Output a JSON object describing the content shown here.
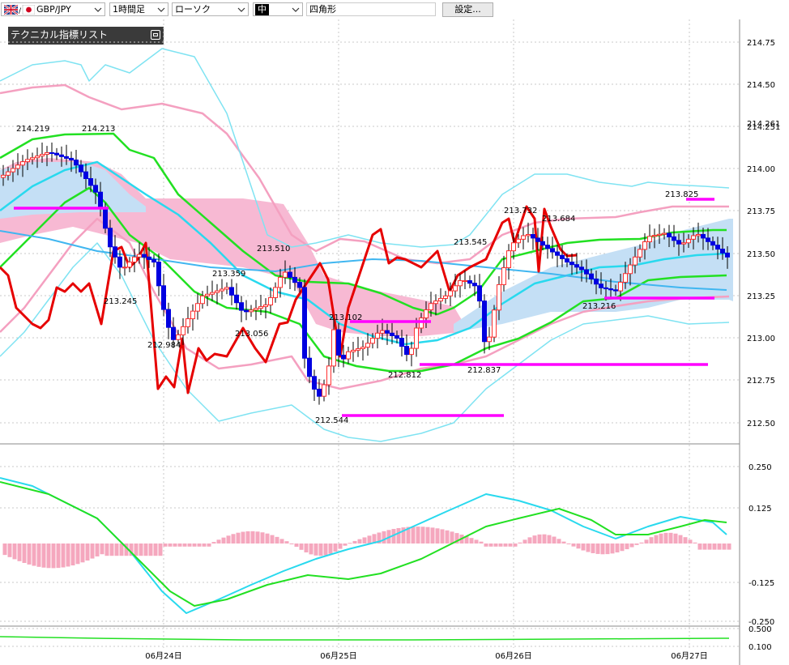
{
  "toolbar": {
    "pair": "GBP/JPY",
    "timeframe": "1時間足",
    "chart_style": "ローソク",
    "mode": "中",
    "draw_tool": "四角形",
    "settings": "設定..."
  },
  "tech_list": {
    "label": "テクニカル指標リスト"
  },
  "chart_data": [
    {
      "type": "candlestick",
      "title": "",
      "indicators": [
        "bollinger-bands",
        "ichimoku-cloud",
        "moving-averages",
        "rsi-style-line"
      ],
      "price_range": [
        212.45,
        214.86
      ],
      "y_ticks": [
        "214.75",
        "214.50",
        "214.261",
        "214.251",
        "214.00",
        "213.75",
        "213.50",
        "213.25",
        "213.00",
        "212.75",
        "212.50"
      ],
      "x_ticks": [
        "06月24日",
        "06月25日",
        "06月26日",
        "06月27日"
      ],
      "annotations": [
        "214.219",
        "214.213",
        "213.245",
        "212.984",
        "213.359",
        "213.056",
        "213.510",
        "213.102",
        "212.544",
        "212.812",
        "213.545",
        "212.837",
        "213.732",
        "213.684",
        "213.825",
        "213.216"
      ],
      "colors": {
        "bullish": "#ff2f2f",
        "bearish": "#0000e0",
        "bb_outer": "#7fe3f2",
        "bb_mid": "#f4a0c0",
        "mid_band": "#22e022",
        "ma_cyan": "#29d9ee",
        "ma_blue": "#40b6f0",
        "line_red": "#e60000",
        "cloud_pink": "#f7b9d3",
        "cloud_blue": "#c4dff5",
        "level_lines": "#ff00ff"
      }
    },
    {
      "type": "macd",
      "y_ticks": [
        "0.250",
        "0.125",
        "-0.125",
        "-0.250"
      ],
      "colors": {
        "histogram": "#f5a7be",
        "signal": "#22e022",
        "macd": "#29d9ee"
      }
    },
    {
      "type": "line",
      "y_ticks": [
        "0.500",
        "0.100"
      ],
      "colors": {
        "line": "#22e022"
      }
    }
  ]
}
